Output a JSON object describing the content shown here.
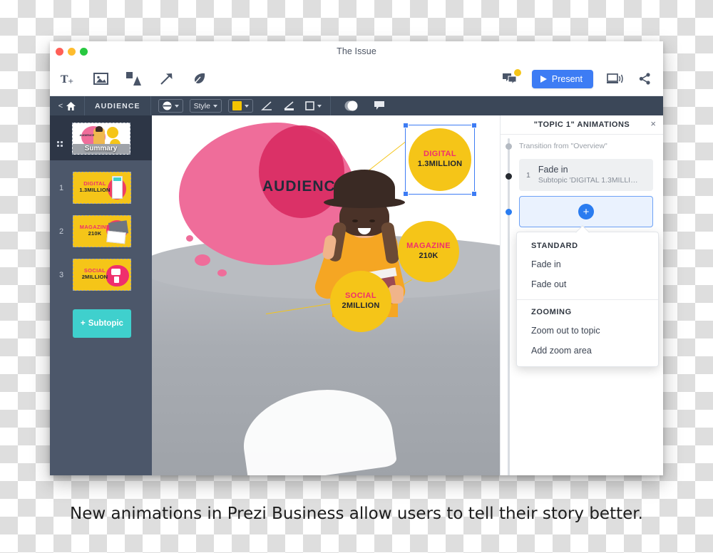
{
  "window": {
    "title": "The Issue",
    "traffic_lights": [
      "close",
      "minimize",
      "zoom"
    ]
  },
  "toolbar": {
    "left_icons": [
      {
        "name": "add-text-icon",
        "label": "T+"
      },
      {
        "name": "add-image-icon",
        "label": "Image"
      },
      {
        "name": "add-shape-icon",
        "label": "Shape"
      },
      {
        "name": "add-arrow-icon",
        "label": "Arrow"
      },
      {
        "name": "add-highlight-icon",
        "label": "Highlight"
      }
    ],
    "right": {
      "comments_label": "Comments",
      "present_label": "Present",
      "remote_label": "Remote presenting",
      "share_label": "Share"
    }
  },
  "editbar": {
    "back_label": "<",
    "home_label": "Home",
    "breadcrumb": "AUDIENCE",
    "shape_label": "Shape",
    "style_label": "Style",
    "color_label": "Color",
    "color_value": "#f5c400",
    "line_start_label": "Line start",
    "line_end_label": "Line end",
    "frame_label": "Frame",
    "opacity_label": "Opacity",
    "comment_label": "Comment"
  },
  "sidebar": {
    "summary": {
      "label": "Summary"
    },
    "items": [
      {
        "num": "1",
        "line1": "DIGITAL",
        "line2": "1.3MILLION"
      },
      {
        "num": "2",
        "line1": "MAGAZINE",
        "line2": "210K"
      },
      {
        "num": "3",
        "line1": "SOCIAL",
        "line2": "2MILLION"
      }
    ],
    "add_subtopic_label": "Subtopic",
    "add_subtopic_plus": "+"
  },
  "canvas": {
    "heading": "AUDIENCE",
    "bubbles": [
      {
        "name": "digital",
        "line1": "DIGITAL",
        "line2": "1.3MILLION"
      },
      {
        "name": "magazine",
        "line1": "MAGAZINE",
        "line2": "210K"
      },
      {
        "name": "social",
        "line1": "SOCIAL",
        "line2": "2MILLION"
      }
    ]
  },
  "panel": {
    "title": "\"TOPIC 1\" ANIMATIONS",
    "close_label": "×",
    "transition_label": "Transition from \"Overview\"",
    "animations": [
      {
        "num": "1",
        "title": "Fade in",
        "subtitle": "Subtopic 'DIGITAL 1.3MILLI…"
      }
    ],
    "add_button_label": "+",
    "menu": {
      "sections": [
        {
          "heading": "STANDARD",
          "items": [
            "Fade in",
            "Fade out"
          ]
        },
        {
          "heading": "ZOOMING",
          "items": [
            "Zoom out to topic",
            "Add zoom area"
          ]
        }
      ]
    }
  },
  "caption": {
    "text": "New animations in Prezi Business allow users to tell their story better."
  },
  "colors": {
    "accent_blue": "#3d7cf4",
    "brand_yellow": "#f5c518",
    "brand_pink": "#ef2f6d",
    "teal": "#3fd0cd",
    "dark_bar": "#3b4758",
    "sidebar": "#4c576a"
  }
}
